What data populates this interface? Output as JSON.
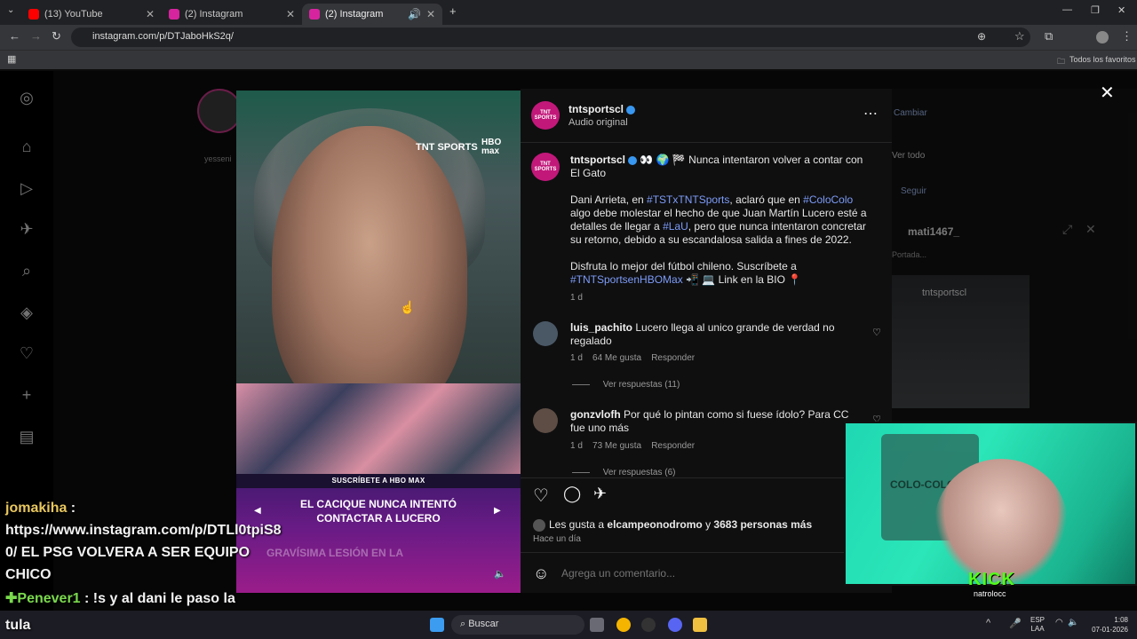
{
  "browser": {
    "tabs": [
      {
        "label": "(13) YouTube",
        "color": "#ff0000"
      },
      {
        "label": "(2) Instagram",
        "color": "#d6249f"
      },
      {
        "label": "(2) Instagram",
        "color": "#d6249f"
      }
    ],
    "url": "instagram.com/p/DTJaboHkS2q/",
    "bookmarks_label": "Todos los favoritos"
  },
  "background": {
    "story_user": "yesseni",
    "side_links": [
      "Cambiar",
      "Ver todo",
      "Seguir"
    ],
    "mini_post_user": "mati1467_",
    "mini_post_sub": "Portada...",
    "mini_post_author": "tntsportscl"
  },
  "video": {
    "banner_top": "SUSCRÍBETE A HBO MAX",
    "banner_title": "EL CACIQUE NUNCA INTENTÓ CONTACTAR A LUCERO",
    "logo": "TNT SPORTS",
    "logo_hbo": "HBO max",
    "bg_headline": "GRAVÍSIMA LESIÓN EN LA"
  },
  "post": {
    "author": "tntsportscl",
    "avatar_text": "TNT SPORTS",
    "audio": "Audio original",
    "caption_title": "👀 🌍 🏁 Nunca intentaron volver a contar con El Gato",
    "caption_p1_a": "Dani Arrieta, en ",
    "caption_p1_tag1": "#TSTxTNTSports",
    "caption_p1_b": ", aclaró que en ",
    "caption_p1_tag2": "#ColoColo",
    "caption_p1_c": " algo debe molestar el hecho de que Juan Martín Lucero esté a detalles de llegar a ",
    "caption_p1_tag3": "#LaU",
    "caption_p1_d": ", pero que nunca intentaron concretar su retorno, debido a su escandalosa salida a fines de 2022.",
    "caption_p2_a": "Disfruta lo mejor del fútbol chileno. Suscríbete a ",
    "caption_p2_tag": "#TNTSportsenHBOMax",
    "caption_p2_b": " 📲 💻 Link en la BIO 📍",
    "caption_time": "1 d",
    "comments": [
      {
        "user": "luis_pachito",
        "text": "Lucero llega al unico grande de verdad no regalado",
        "time": "1 d",
        "likes": "64 Me gusta",
        "reply": "Responder",
        "replies": "Ver respuestas (11)"
      },
      {
        "user": "gonzvlofh",
        "text": "Por qué lo pintan como si fuese ídolo? Para CC fue uno más",
        "time": "1 d",
        "likes": "73 Me gusta",
        "reply": "Responder",
        "replies": "Ver respuestas (6)"
      }
    ],
    "likes_prefix": "Les gusta a ",
    "likes_user": "elcampeonodromo",
    "likes_suffix": " y ",
    "likes_count": "3683 personas más",
    "posted": "Hace un día",
    "comment_placeholder": "Agrega un comentario..."
  },
  "stream": {
    "chat": [
      {
        "user": "jomakiha",
        "sep": " :"
      },
      {
        "text": "https://www.instagram.com/p/DTLl0tpiS8"
      },
      {
        "text": "0/ EL PSG VOLVERA A SER EQUIPO"
      },
      {
        "text": "CHICO"
      },
      {
        "user": "Penever1",
        "text": " : !s y al dani le paso la"
      },
      {
        "text": "tula"
      }
    ],
    "cam_logo": "KICK",
    "cam_handle": "natrolocc",
    "cam_badge": "COLO-COLO"
  },
  "taskbar": {
    "search": "Buscar",
    "lang_top": "ESP",
    "lang_bottom": "LAA",
    "time": "1:08",
    "date": "07-01-2026"
  }
}
